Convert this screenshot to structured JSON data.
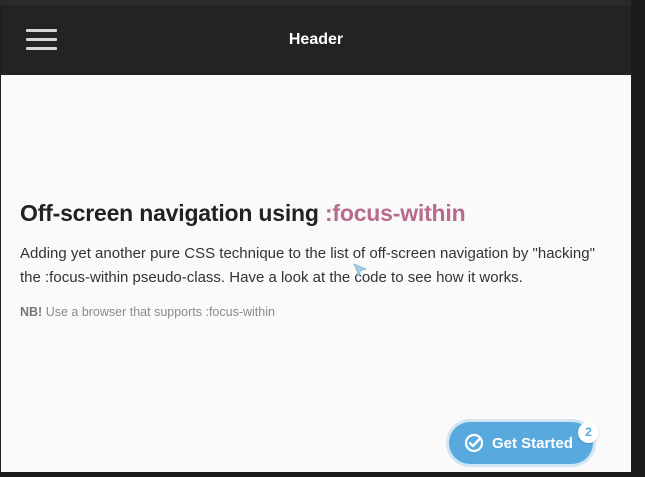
{
  "header": {
    "title": "Header",
    "menu_icon": "hamburger-menu-icon"
  },
  "main": {
    "title_prefix": "Off-screen navigation using ",
    "title_accent": ":focus-within",
    "description": "Adding yet another pure CSS technique to the list of off-screen navigation by \"hacking\" the :focus-within pseudo-class. Have a look at the code to see how it works.",
    "note_strong": "NB!",
    "note_text": " Use a browser that supports :focus-within"
  },
  "widget": {
    "label": "Get Started",
    "badge_count": "2",
    "icon": "check-circle-icon"
  },
  "colors": {
    "header_bg": "#232323",
    "accent": "#b86b8c",
    "button": "#57a9de"
  }
}
